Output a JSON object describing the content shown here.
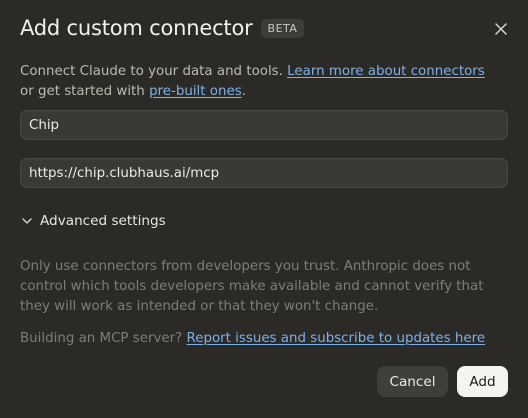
{
  "dialog": {
    "title": "Add custom connector",
    "badge": "BETA",
    "close_icon": "close-icon"
  },
  "intro": {
    "text_before": "Connect Claude to your data and tools. ",
    "link_learn": "Learn more about connectors",
    "text_middle": " or get started with ",
    "link_prebuilt": "pre-built ones",
    "text_after": "."
  },
  "form": {
    "name_value": "Chip",
    "url_value": "https://chip.clubhaus.ai/mcp"
  },
  "advanced": {
    "label": "Advanced settings",
    "icon": "chevron-down-icon"
  },
  "warning": {
    "text": "Only use connectors from developers you trust. Anthropic does not control which tools developers make available and cannot verify that they will work as intended or that they won't change."
  },
  "building": {
    "text_before": "Building an MCP server? ",
    "link": "Report issues and subscribe to updates here"
  },
  "actions": {
    "cancel_label": "Cancel",
    "add_label": "Add"
  },
  "colors": {
    "background": "#2b2a27",
    "link": "#7fb0e8",
    "primary_button": "#f5f4ef"
  }
}
